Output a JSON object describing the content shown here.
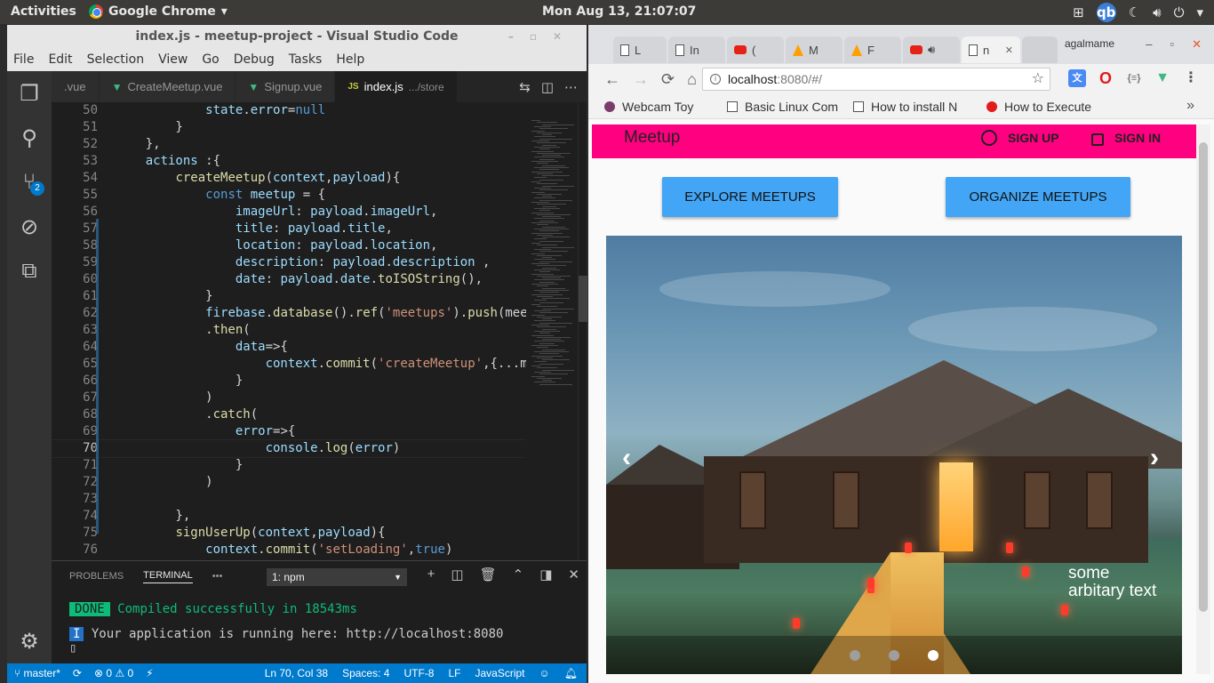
{
  "topbar": {
    "activities": "Activities",
    "app_menu": "Google Chrome",
    "clock": "Mon Aug 13, 21:07:07",
    "qb_label": "qb"
  },
  "vscode": {
    "title": "index.js - meetup-project - Visual Studio Code",
    "menu": [
      "File",
      "Edit",
      "Selection",
      "View",
      "Go",
      "Debug",
      "Tasks",
      "Help"
    ],
    "tabs": [
      {
        "label": ".vue"
      },
      {
        "label": "CreateMeetup.vue"
      },
      {
        "label": "Signup.vue"
      },
      {
        "label": "index.js",
        "path": ".../store"
      }
    ],
    "scm_badge": "2",
    "cursor_line": 70,
    "code_lines": [
      {
        "n": "50",
        "html": "            <span class=\"v\">state</span>.<span class=\"v\">error</span>=<span class=\"k\">null</span>"
      },
      {
        "n": "51",
        "html": "        }"
      },
      {
        "n": "52",
        "html": "    },"
      },
      {
        "n": "53",
        "html": "    <span class=\"v\">actions</span> :{"
      },
      {
        "n": "54",
        "html": "        <span class=\"f\">createMeetup</span>(<span class=\"v\">context</span>,<span class=\"v\">payload</span>){"
      },
      {
        "n": "55",
        "html": "            <span class=\"k\">const</span> <span class=\"v\">meetup</span> = {"
      },
      {
        "n": "56",
        "html": "                <span class=\"v\">imageUrl</span>: <span class=\"v\">payload</span>.<span class=\"v\">imageUrl</span>,"
      },
      {
        "n": "57",
        "html": "                <span class=\"v\">title</span>: <span class=\"v\">payload</span>.<span class=\"v\">title</span>,"
      },
      {
        "n": "58",
        "html": "                <span class=\"v\">location</span>: <span class=\"v\">payload</span>.<span class=\"v\">location</span>,"
      },
      {
        "n": "59",
        "html": "                <span class=\"v\">description</span>: <span class=\"v\">payload</span>.<span class=\"v\">description</span> ,"
      },
      {
        "n": "60",
        "html": "                <span class=\"v\">date</span>: <span class=\"v\">payload</span>.<span class=\"v\">date</span>.<span class=\"f\">toISOString</span>(),"
      },
      {
        "n": "61",
        "html": "            }"
      },
      {
        "n": "62",
        "html": "            <span class=\"v\">firebase</span>.<span class=\"f\">database</span>().<span class=\"f\">ref</span>(<span class=\"s\">'meetups'</span>).<span class=\"f\">push</span>(meet"
      },
      {
        "n": "63",
        "html": "            .<span class=\"f\">then</span>("
      },
      {
        "n": "64",
        "html": "                <span class=\"v\">data</span>=>{"
      },
      {
        "n": "65",
        "html": "                    <span class=\"v\">context</span>.<span class=\"f\">commit</span>(<span class=\"s\">'createMeetup'</span>,{...me"
      },
      {
        "n": "66",
        "html": "                }"
      },
      {
        "n": "67",
        "html": "            )"
      },
      {
        "n": "68",
        "html": "            .<span class=\"f\">catch</span>("
      },
      {
        "n": "69",
        "html": "                <span class=\"v\">error</span>=>{"
      },
      {
        "n": "70",
        "html": "                    <span class=\"v\">console</span>.<span class=\"f\">log</span>(<span class=\"v\">error</span>)"
      },
      {
        "n": "71",
        "html": "                }"
      },
      {
        "n": "72",
        "html": "            )"
      },
      {
        "n": "73",
        "html": ""
      },
      {
        "n": "74",
        "html": "        },"
      },
      {
        "n": "75",
        "html": "        <span class=\"f\">signUserUp</span>(<span class=\"v\">context</span>,<span class=\"v\">payload</span>){"
      },
      {
        "n": "76",
        "html": "            <span class=\"v\">context</span>.<span class=\"f\">commit</span>(<span class=\"s\">'setLoading'</span>,<span class=\"k\">true</span>)"
      }
    ],
    "panel": {
      "tabs": [
        "PROBLEMS",
        "TERMINAL",
        "•••"
      ],
      "terminal_select": "1: npm",
      "done_badge": "DONE",
      "done_text": "Compiled successfully in 18543ms",
      "info_badge": "I",
      "info_text": "Your application is running here: http://localhost:8080"
    },
    "statusbar": {
      "branch": "master*",
      "errors": "0",
      "warnings": "0",
      "position": "Ln 70, Col 38",
      "spaces": "Spaces: 4",
      "encoding": "UTF-8",
      "eol": "LF",
      "language": "JavaScript"
    }
  },
  "chrome": {
    "tabs": [
      {
        "label": "L",
        "icon": "doc"
      },
      {
        "label": "In",
        "icon": "doc"
      },
      {
        "label": "(",
        "icon": "youtube"
      },
      {
        "label": "M",
        "icon": "firebase"
      },
      {
        "label": "F",
        "icon": "firebase"
      },
      {
        "label": "",
        "icon": "youtube-audio"
      },
      {
        "label": "n",
        "icon": "doc",
        "active": true
      }
    ],
    "profile": "agalmame",
    "url_host": "localhost",
    "url_rest": ":8080/#/",
    "bookmarks": [
      {
        "label": "Webcam Toy",
        "icon": "webcam"
      },
      {
        "label": "Basic Linux Com",
        "icon": "doc"
      },
      {
        "label": "How to install N",
        "icon": "doc"
      },
      {
        "label": "How to Execute",
        "icon": "red-circle"
      }
    ],
    "bookmarks_more": "»"
  },
  "app": {
    "title": "Meetup",
    "sign_up": "SIGN UP",
    "sign_in": "SIGN IN",
    "explore_button": "EXPLORE MEETUPS",
    "organize_button": "ORGANIZE MEETUPS",
    "carousel_caption": "some arbitary text",
    "carousel_dots": 3,
    "carousel_active_dot": 3
  }
}
